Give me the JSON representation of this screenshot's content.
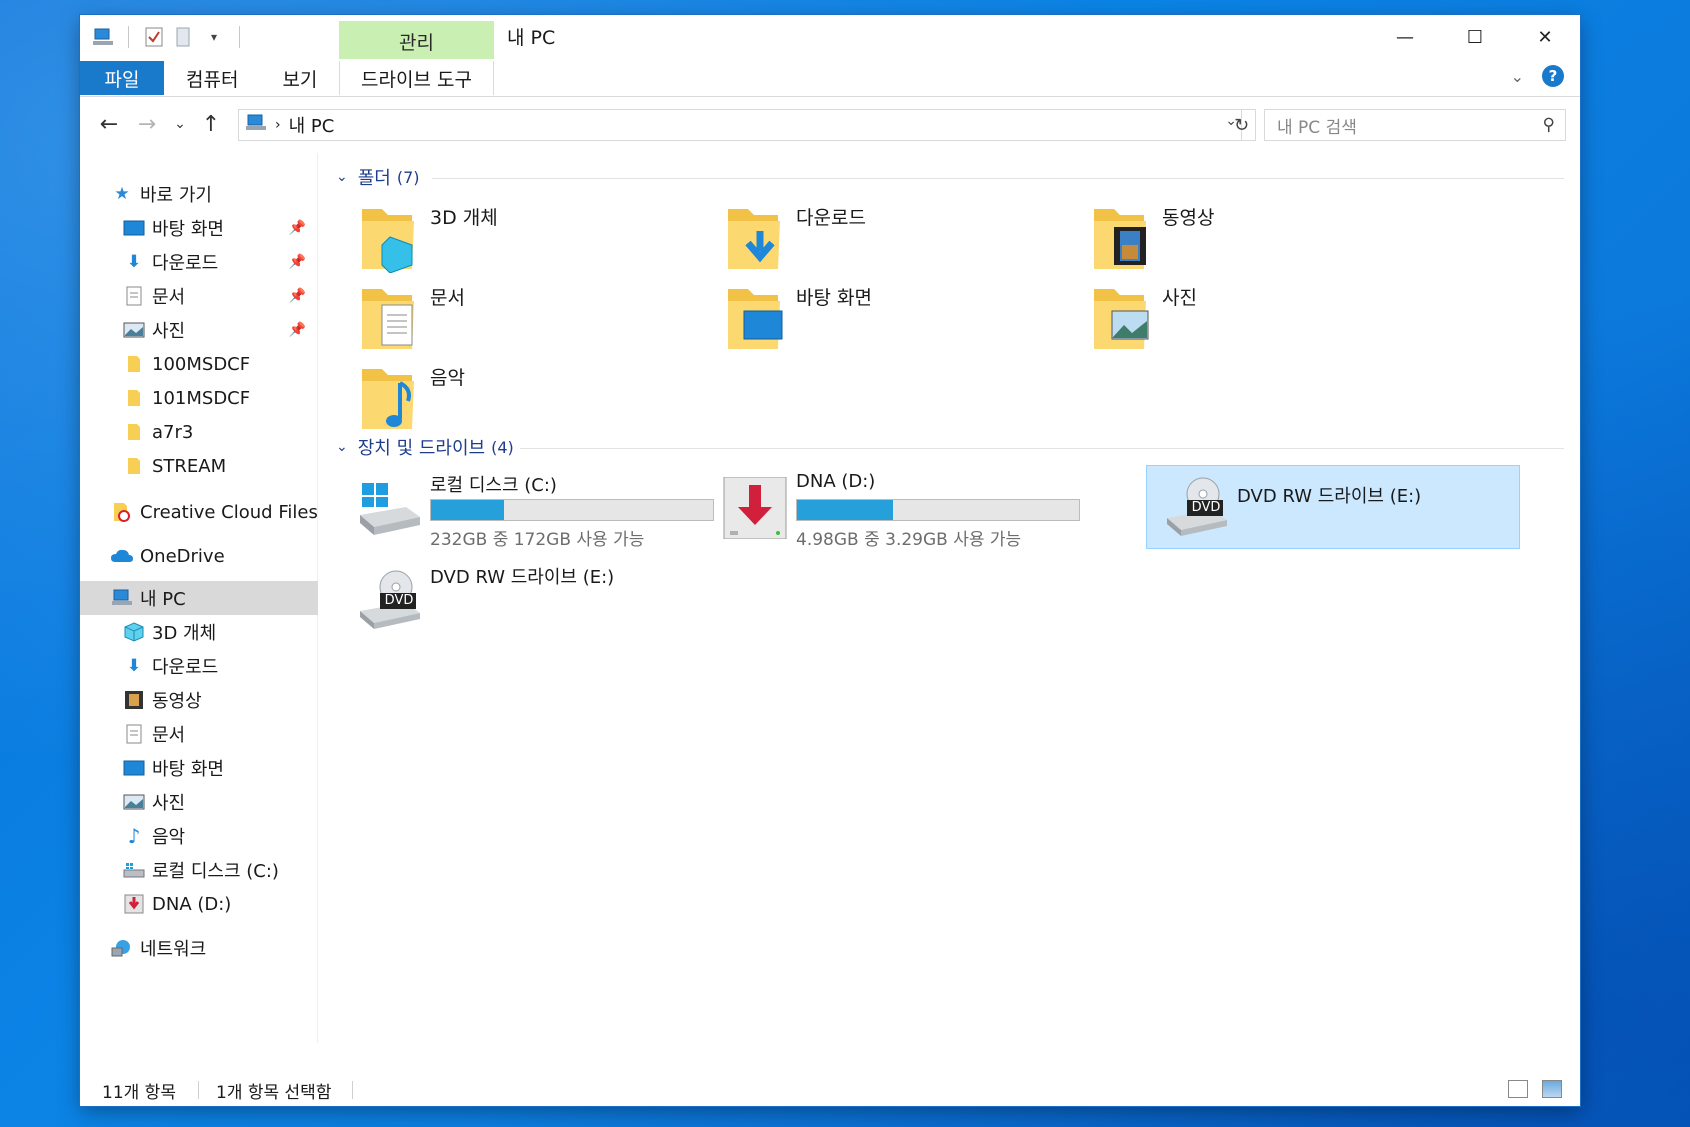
{
  "window": {
    "title": "내 PC",
    "manage_tab": "관리",
    "controls": {
      "minimize": "—",
      "maximize": "☐",
      "close": "✕"
    }
  },
  "ribbon": {
    "tabs": [
      {
        "label": "파일"
      },
      {
        "label": "컴퓨터"
      },
      {
        "label": "보기"
      },
      {
        "label": "드라이브 도구"
      }
    ]
  },
  "address": {
    "path": "내 PC",
    "search_placeholder": "내 PC 검색"
  },
  "nav": {
    "quick_access": "바로 가기",
    "quick_items": [
      {
        "label": "바탕 화면",
        "icon": "desktop-icon",
        "pinned": true
      },
      {
        "label": "다운로드",
        "icon": "download-arrow-icon",
        "pinned": true
      },
      {
        "label": "문서",
        "icon": "document-icon",
        "pinned": true
      },
      {
        "label": "사진",
        "icon": "picture-icon",
        "pinned": true
      },
      {
        "label": "100MSDCF",
        "icon": "folder-icon",
        "pinned": false
      },
      {
        "label": "101MSDCF",
        "icon": "folder-icon",
        "pinned": false
      },
      {
        "label": "a7r3",
        "icon": "folder-icon",
        "pinned": false
      },
      {
        "label": "STREAM",
        "icon": "folder-icon",
        "pinned": false
      }
    ],
    "creative_cloud": "Creative Cloud Files",
    "onedrive": "OneDrive",
    "this_pc": "내 PC",
    "pc_items": [
      {
        "label": "3D 개체",
        "icon": "3d-objects-icon"
      },
      {
        "label": "다운로드",
        "icon": "download-arrow-icon"
      },
      {
        "label": "동영상",
        "icon": "video-icon"
      },
      {
        "label": "문서",
        "icon": "document-icon"
      },
      {
        "label": "바탕 화면",
        "icon": "desktop-icon"
      },
      {
        "label": "사진",
        "icon": "picture-icon"
      },
      {
        "label": "음악",
        "icon": "music-icon"
      },
      {
        "label": "로컬 디스크 (C:)",
        "icon": "local-disk-icon"
      },
      {
        "label": "DNA (D:)",
        "icon": "dna-drive-icon"
      }
    ],
    "network": "네트워크"
  },
  "content": {
    "folders_header": "폴더",
    "folders_count": "(7)",
    "folders": [
      {
        "label": "3D 개체",
        "icon": "3d-objects-icon"
      },
      {
        "label": "다운로드",
        "icon": "download-arrow-icon"
      },
      {
        "label": "동영상",
        "icon": "video-icon"
      },
      {
        "label": "문서",
        "icon": "document-icon"
      },
      {
        "label": "바탕 화면",
        "icon": "desktop-icon"
      },
      {
        "label": "사진",
        "icon": "picture-icon"
      },
      {
        "label": "음악",
        "icon": "music-icon"
      }
    ],
    "drives_header": "장치 및 드라이브",
    "drives_count": "(4)",
    "drives": [
      {
        "label": "로컬 디스크 (C:)",
        "free_text": "232GB 중 172GB 사용 가능",
        "used_fraction": 0.26,
        "icon": "local-disk-icon"
      },
      {
        "label": "DNA (D:)",
        "free_text": "4.98GB 중 3.29GB 사용 가능",
        "used_fraction": 0.34,
        "icon": "dna-drive-icon"
      },
      {
        "label": "DVD RW 드라이브 (E:)",
        "icon": "dvd-drive-icon",
        "selected": true
      },
      {
        "label": "DVD RW 드라이브 (E:)",
        "icon": "dvd-drive-icon",
        "selected": false
      }
    ],
    "dvd_badge": "DVD"
  },
  "status": {
    "item_count": "11개 항목",
    "selected_count": "1개 항목 선택함"
  },
  "colors": {
    "accent": "#1979ca",
    "manage_tab": "#c9efb3",
    "selection": "#cce8ff",
    "progress": "#26a0da",
    "group_header": "#1e3d8b"
  }
}
